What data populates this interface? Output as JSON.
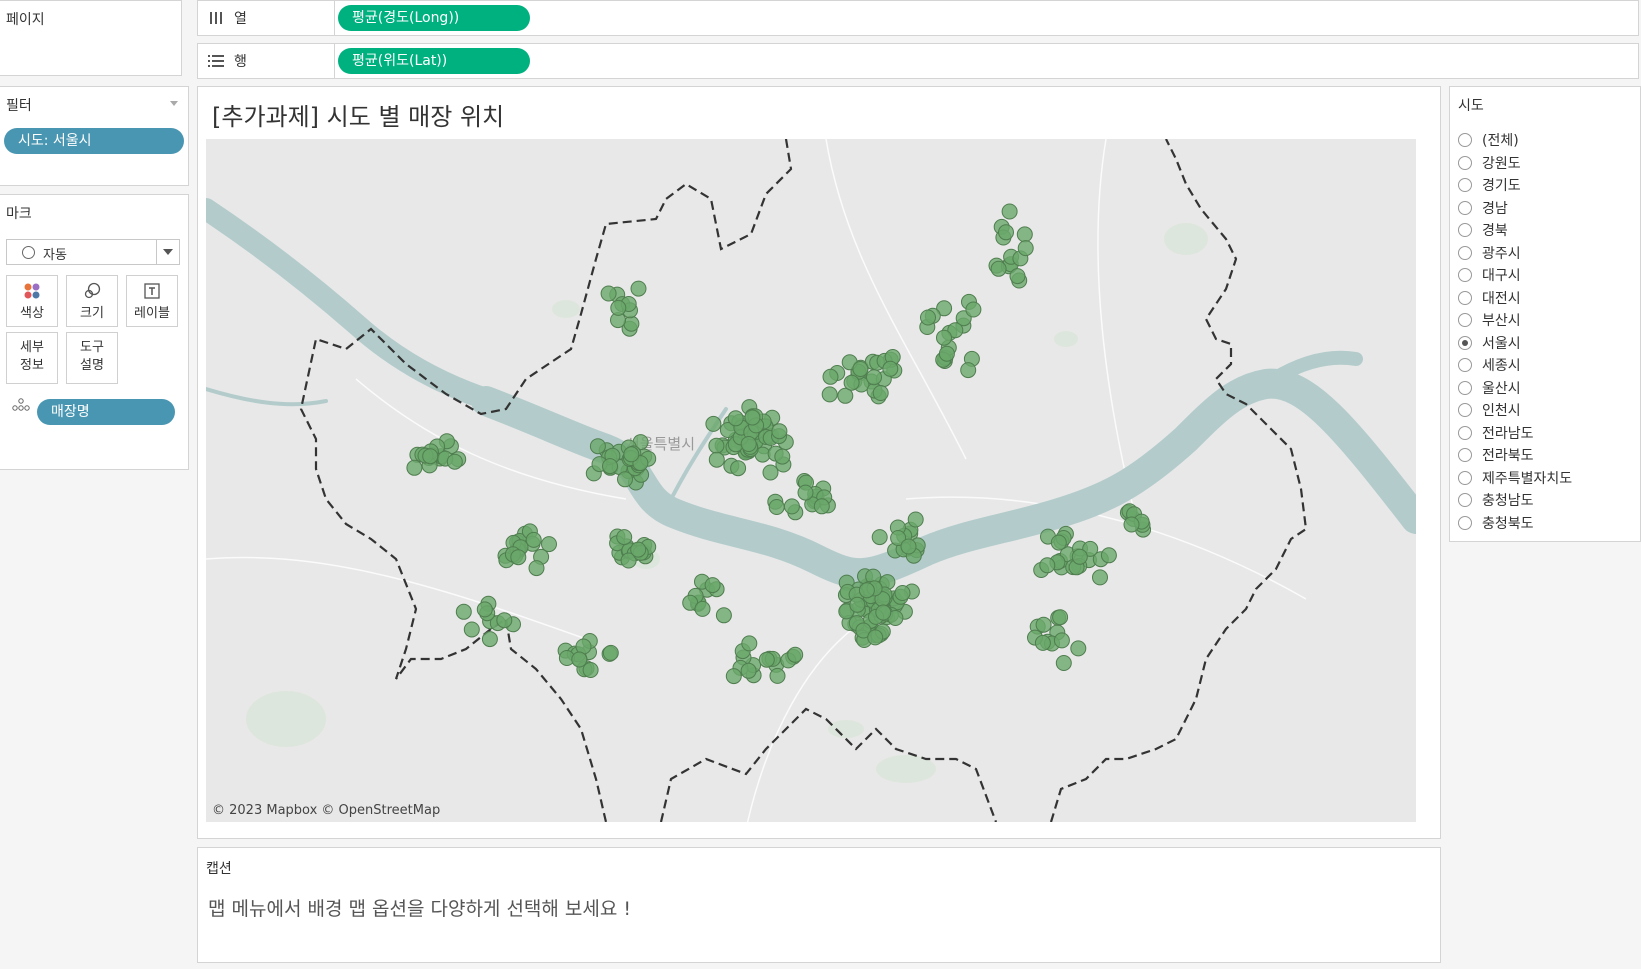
{
  "pages": {
    "title": "페이지"
  },
  "shelves": {
    "columns": {
      "label": "열",
      "pill": "평균(경도(Long))"
    },
    "rows": {
      "label": "행",
      "pill": "평균(위도(Lat))"
    }
  },
  "filters": {
    "title": "필터",
    "pill": "시도: 서울시"
  },
  "marks": {
    "title": "마크",
    "type": "자동",
    "buttons": [
      {
        "label": "색상",
        "icon": "color-dots-icon"
      },
      {
        "label": "크기",
        "icon": "size-icon"
      },
      {
        "label": "레이블",
        "icon": "label-icon"
      },
      {
        "label": "세부 정보",
        "line1": "세부",
        "line2": "정보",
        "icon": "detail-icon"
      },
      {
        "label": "도구 설명",
        "line1": "도구",
        "line2": "설명",
        "icon": "tooltip-icon"
      }
    ],
    "detail_pill": "매장명"
  },
  "view": {
    "title": "[추가과제] 시도 별 매장 위치",
    "map_label": "서울특별시",
    "attribution": "© 2023 Mapbox © OpenStreetMap"
  },
  "caption": {
    "title": "캡션",
    "text": "맵 메뉴에서 배경 맵 옵션을 다양하게 선택해 보세요 !"
  },
  "sido_filter": {
    "title": "시도",
    "options": [
      {
        "label": "(전체)",
        "selected": false
      },
      {
        "label": "강원도",
        "selected": false
      },
      {
        "label": "경기도",
        "selected": false
      },
      {
        "label": "경남",
        "selected": false
      },
      {
        "label": "경북",
        "selected": false
      },
      {
        "label": "광주시",
        "selected": false
      },
      {
        "label": "대구시",
        "selected": false
      },
      {
        "label": "대전시",
        "selected": false
      },
      {
        "label": "부산시",
        "selected": false
      },
      {
        "label": "서울시",
        "selected": true
      },
      {
        "label": "세종시",
        "selected": false
      },
      {
        "label": "울산시",
        "selected": false
      },
      {
        "label": "인천시",
        "selected": false
      },
      {
        "label": "전라남도",
        "selected": false
      },
      {
        "label": "전라북도",
        "selected": false
      },
      {
        "label": "제주특별자치도",
        "selected": false
      },
      {
        "label": "충청남도",
        "selected": false
      },
      {
        "label": "충청북도",
        "selected": false
      }
    ]
  },
  "colors": {
    "shelf_pill": "#00b180",
    "dimension_pill": "#4996b2",
    "mark_fill": "#6aa86a",
    "river": "#b3cccb",
    "boundary": "#333333"
  }
}
